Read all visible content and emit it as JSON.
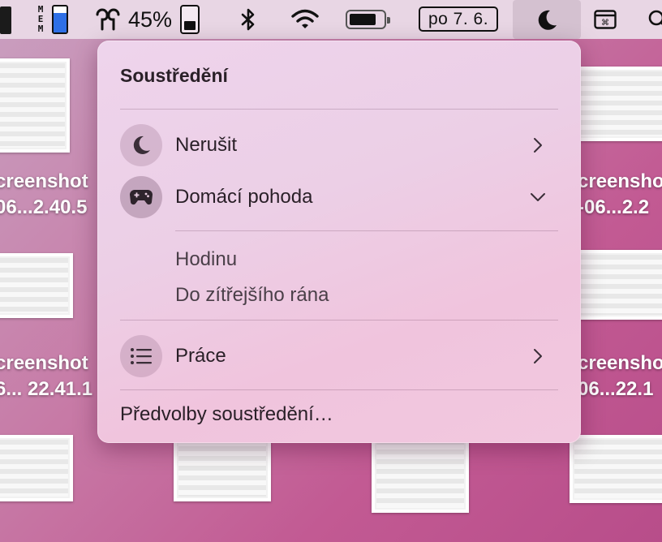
{
  "menubar": {
    "mem_label": "M\nE\nM",
    "mem_fraction": 0.75,
    "battery_percent": "45%",
    "battery_fraction": 0.45,
    "date": "po 7. 6."
  },
  "desktop": {
    "labels": [
      {
        "text": "creenshot"
      },
      {
        "text": "06...2.40.5"
      },
      {
        "text": "creenshot"
      },
      {
        "text": "6... 22.41.1"
      },
      {
        "text": "creensho"
      },
      {
        "text": "-06...2.2"
      },
      {
        "text": "creensho"
      },
      {
        "text": "06...22.1"
      }
    ]
  },
  "focus": {
    "title": "Soustředění",
    "items": [
      {
        "label": "Nerušit"
      },
      {
        "label": "Domácí pohoda"
      },
      {
        "label": "Práce"
      }
    ],
    "durations": [
      "Hodinu",
      "Do zítřejšího rána"
    ],
    "preferences": "Předvolby soustředění…"
  },
  "colors": {
    "menubar_bg": "#e8d6e4",
    "accent_blue": "#2f6fe6",
    "popover_text": "#2a2028"
  }
}
